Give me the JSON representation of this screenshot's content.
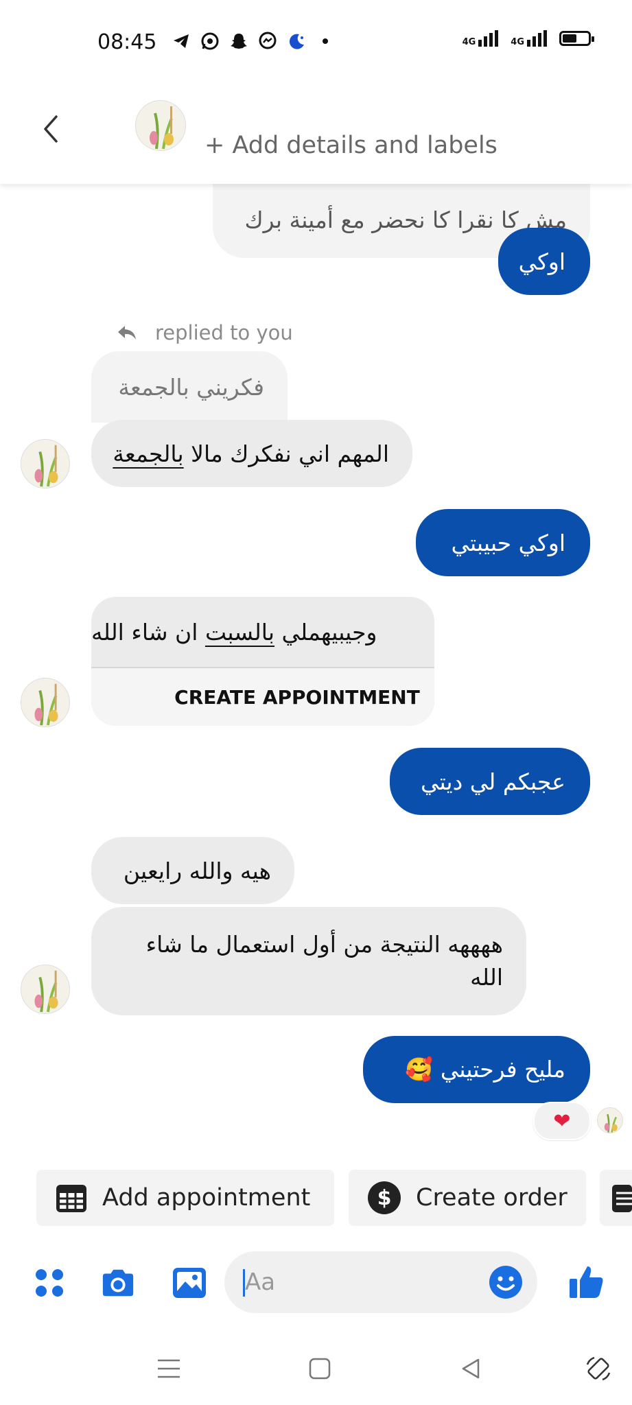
{
  "status_bar": {
    "time": "08:45",
    "network_1": "4G",
    "network_2": "4G",
    "battery_level": 0.55
  },
  "header": {
    "add_details": "+ Add details and labels"
  },
  "messages": {
    "m1": "مش كا نقرا كا نحضر مع أمينة برك",
    "m2": "اوكي",
    "replied_label": "replied to you",
    "quoted": "فكريني بالجمعة",
    "m3_pre": "المهم اني نفكرك مالا ",
    "m3_link": "بالجمعة",
    "m4": "اوكي حبيبتي",
    "m5_pre": "وجيبيهملي ",
    "m5_link": "بالسبت",
    "m5_post": " ان شاء الله",
    "create_appointment": "CREATE APPOINTMENT",
    "m6": "عجبكم لي ديتي",
    "m7": "هيه والله رايعين",
    "m8_line1": "ههههه النتيجة من أول استعمال ما شاء",
    "m8_line2": "الله",
    "m9": "مليح فرحتيني 🥰",
    "reaction": "❤"
  },
  "actions": {
    "add_appointment": "Add appointment",
    "create_order": "Create order"
  },
  "composer": {
    "placeholder": "Aa"
  },
  "colors": {
    "accent": "#0a4fab",
    "icon_blue": "#1a6ee0",
    "incoming_bubble": "#ebebeb"
  }
}
